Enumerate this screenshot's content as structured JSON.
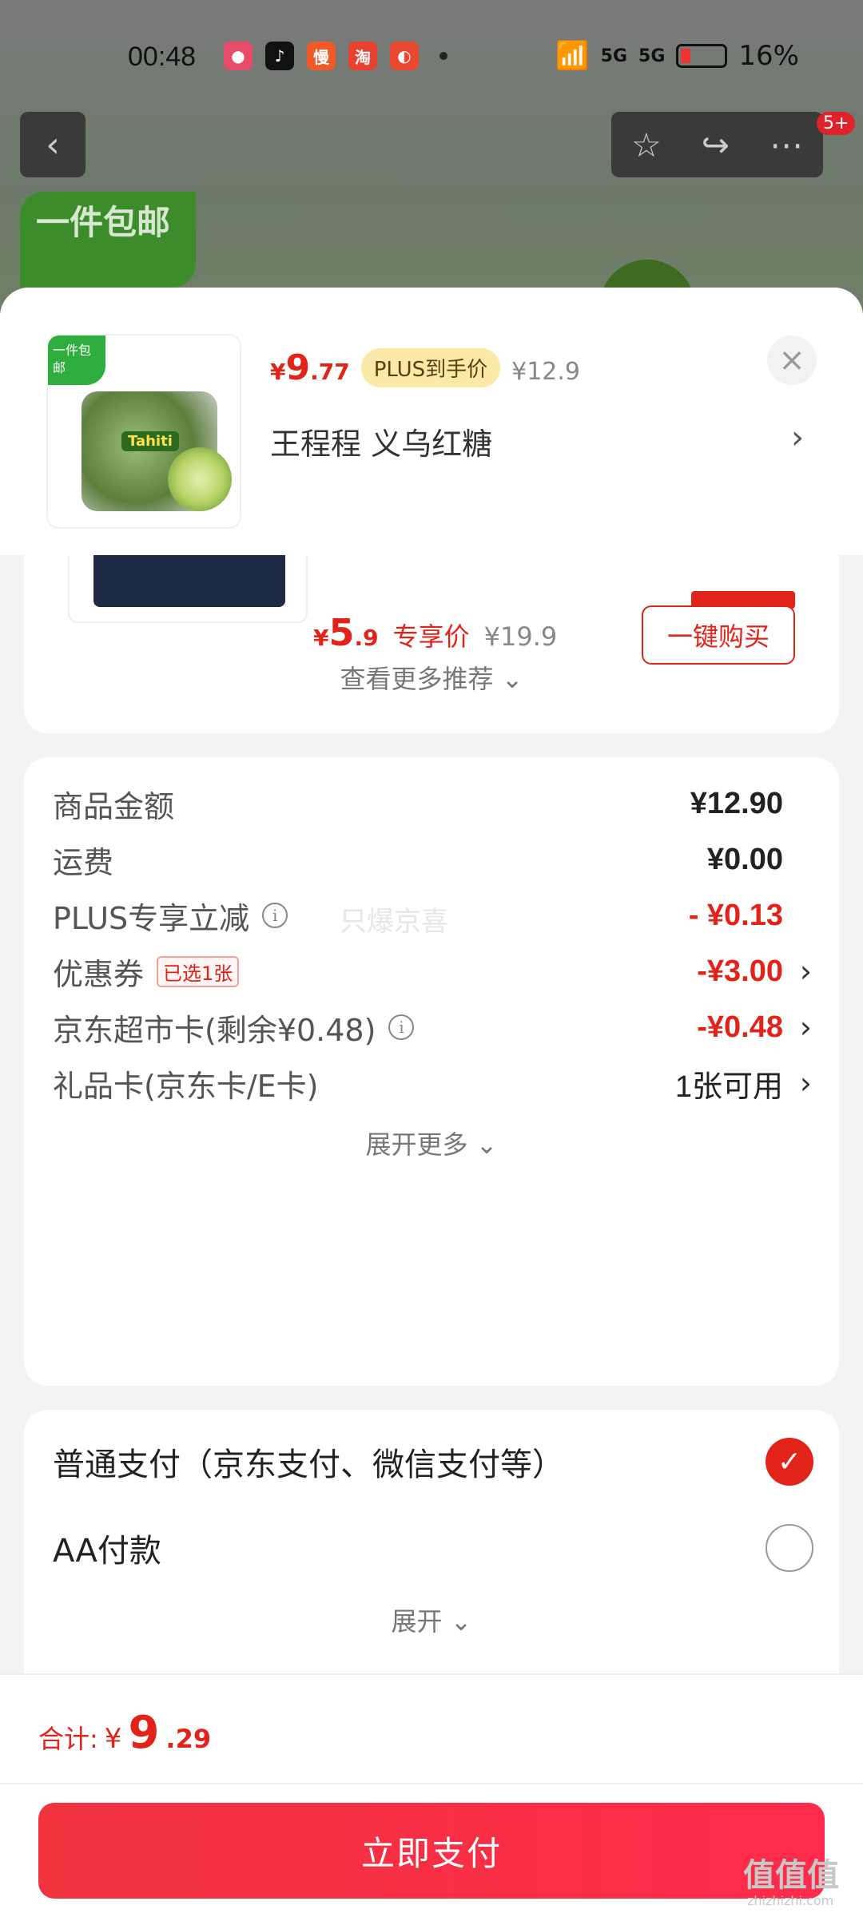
{
  "status_bar": {
    "time": "00:48",
    "network_1": "5G",
    "network_2": "5G",
    "battery_percent": "16%"
  },
  "background": {
    "free_shipping_badge": "一件包邮",
    "notification_badge": "5+"
  },
  "product": {
    "thumb_tag": "一件包邮",
    "thumb_label": "Tahiti",
    "price_currency": "¥",
    "price_int": "9",
    "price_dec": ".77",
    "plus_tag": "PLUS到手价",
    "original_price": "¥12.9",
    "variant": "王程程  义乌红糖",
    "variant_arrow": "›",
    "close": "×"
  },
  "recommend": {
    "price_currency": "¥",
    "price_int": "5",
    "price_dec": ".9",
    "price_tag": "专享价",
    "original_price": "¥19.9",
    "buy_button": "一键购买",
    "see_more": "查看更多推荐 ⌄"
  },
  "details": {
    "watermark": "只爆京喜",
    "rows": [
      {
        "label": "商品金额",
        "value": "¥12.90"
      },
      {
        "label": "运费",
        "value": "¥0.00"
      },
      {
        "label": "PLUS专享立减",
        "value": "- ¥0.13"
      },
      {
        "label": "优惠券",
        "tag": "已选1张",
        "value": "-¥3.00"
      },
      {
        "label": "京东超市卡(剩余¥0.48)",
        "value": "-¥0.48"
      },
      {
        "label": "礼品卡(京东卡/E卡)",
        "value": "1张可用"
      }
    ],
    "expand_more": "展开更多 ⌄"
  },
  "payment": {
    "options": [
      {
        "label": "普通支付（京东支付、微信支付等）",
        "selected": true
      },
      {
        "label": "AA付款",
        "selected": false
      }
    ],
    "expand": "展开 ⌄"
  },
  "footer": {
    "total_label": "合计:",
    "total_currency": "¥",
    "total_int": "9",
    "total_dec": ".29",
    "pay_button": "立即支付",
    "site_mark": "值值值",
    "site_url": "zhizhizhi.com"
  },
  "colors": {
    "accent_red": "#e2231a",
    "plus_pill": "#fbe9a8",
    "pay_button": "#f0333f"
  }
}
